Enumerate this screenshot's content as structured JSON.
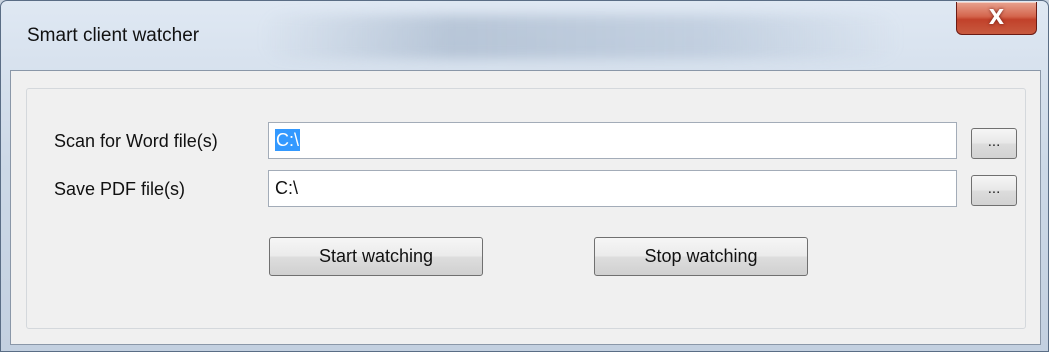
{
  "window": {
    "title": "Smart client watcher",
    "close_label": "X"
  },
  "form": {
    "scan": {
      "label": "Scan for Word file(s)",
      "value": "C:\\",
      "browse_label": "..."
    },
    "save": {
      "label": "Save PDF file(s)",
      "value": "C:\\",
      "browse_label": "..."
    },
    "start_label": "Start watching",
    "stop_label": "Stop watching"
  },
  "colors": {
    "selection": "#3399ff",
    "close_button": "#c8412a",
    "dialog_background": "#f0f0f0"
  },
  "icons": {
    "close": "close-icon"
  }
}
